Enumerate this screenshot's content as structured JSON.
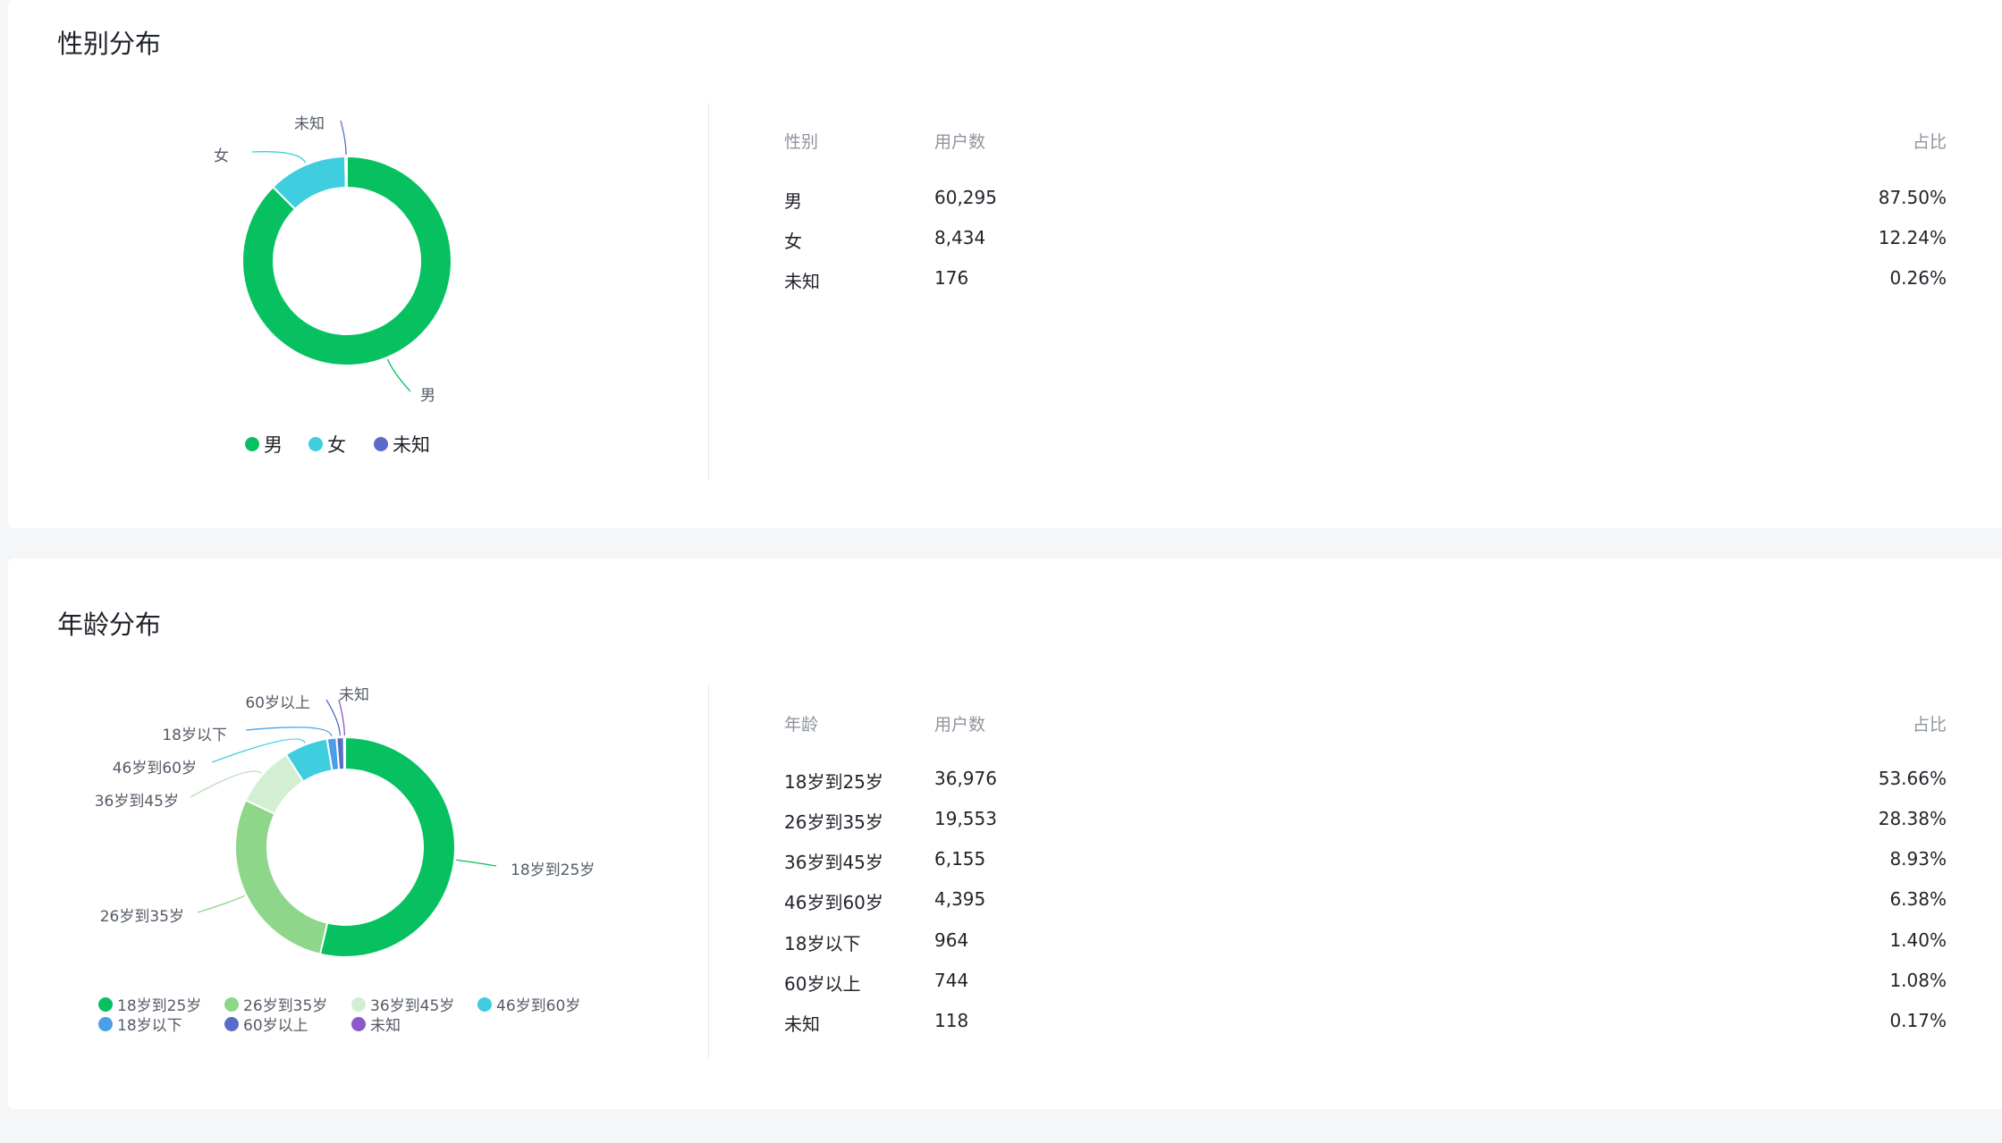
{
  "gender": {
    "title": "性别分布",
    "headers": [
      "性别",
      "用户数",
      "占比"
    ],
    "rows": [
      {
        "label": "男",
        "count": "60,295",
        "pct": "87.50%"
      },
      {
        "label": "女",
        "count": "8,434",
        "pct": "12.24%"
      },
      {
        "label": "未知",
        "count": "176",
        "pct": "0.26%"
      }
    ],
    "legend": [
      "男",
      "女",
      "未知"
    ],
    "colors": [
      "#07c160",
      "#3fcde0",
      "#5b6bc9"
    ]
  },
  "age": {
    "title": "年龄分布",
    "headers": [
      "年龄",
      "用户数",
      "占比"
    ],
    "rows": [
      {
        "label": "18岁到25岁",
        "count": "36,976",
        "pct": "53.66%"
      },
      {
        "label": "26岁到35岁",
        "count": "19,553",
        "pct": "28.38%"
      },
      {
        "label": "36岁到45岁",
        "count": "6,155",
        "pct": "8.93%"
      },
      {
        "label": "46岁到60岁",
        "count": "4,395",
        "pct": "6.38%"
      },
      {
        "label": "18岁以下",
        "count": "964",
        "pct": "1.40%"
      },
      {
        "label": "60岁以上",
        "count": "744",
        "pct": "1.08%"
      },
      {
        "label": "未知",
        "count": "118",
        "pct": "0.17%"
      }
    ],
    "legend": [
      "18岁到25岁",
      "26岁到35岁",
      "36岁到45岁",
      "46岁到60岁",
      "18岁以下",
      "60岁以上",
      "未知"
    ],
    "colors": [
      "#07c160",
      "#8ed68a",
      "#d3efd3",
      "#3fcde0",
      "#4a9fe8",
      "#5b6bc9",
      "#8b59c8"
    ]
  },
  "chart_data": [
    {
      "type": "pie",
      "title": "性别分布",
      "categories": [
        "男",
        "女",
        "未知"
      ],
      "values": [
        60295,
        8434,
        176
      ],
      "legend": "bottom"
    },
    {
      "type": "pie",
      "title": "年龄分布",
      "categories": [
        "18岁到25岁",
        "26岁到35岁",
        "36岁到45岁",
        "46岁到60岁",
        "18岁以下",
        "60岁以上",
        "未知"
      ],
      "values": [
        36976,
        19553,
        6155,
        4395,
        964,
        744,
        118
      ],
      "legend": "bottom"
    }
  ]
}
